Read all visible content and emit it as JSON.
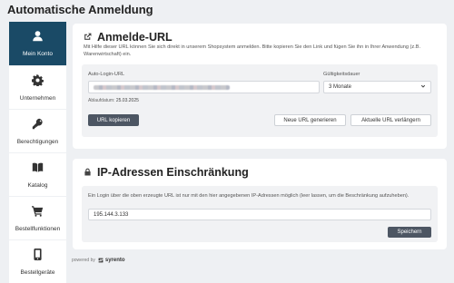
{
  "page": {
    "title": "Automatische Anmeldung"
  },
  "sidebar": {
    "items": [
      {
        "label": "Mein Konto",
        "icon": "user-icon",
        "active": true
      },
      {
        "label": "Unternehmen",
        "icon": "gear-icon"
      },
      {
        "label": "Berechtigungen",
        "icon": "key-icon"
      },
      {
        "label": "Katalog",
        "icon": "book-icon"
      },
      {
        "label": "Bestellfunktionen",
        "icon": "cart-icon"
      },
      {
        "label": "Bestellgeräte",
        "icon": "phone-icon"
      }
    ]
  },
  "footer": {
    "powered_by": "powered by",
    "brand": "syrento"
  },
  "login_url": {
    "title": "Anmelde-URL",
    "icon": "external-link-icon",
    "description": "Mit Hilfe dieser URL können Sie sich direkt in unserem Shopsystem anmelden. Bitte kopieren Sie den Link und fügen Sie ihn in Ihrer Anwendung (z.B. Warenwirtschaft) ein.",
    "url_label": "Auto-Login-URL",
    "expiry_prefix": "Ablaufdatum:",
    "expiry_date": "25.03.2025",
    "validity_label": "Gültigkeitsdauer",
    "validity_value": "3 Monate",
    "copy_button": "URL kopieren",
    "generate_button": "Neue URL generieren",
    "extend_button": "Aktuelle URL verlängern"
  },
  "ip_restriction": {
    "title": "IP-Adressen Einschränkung",
    "icon": "lock-icon",
    "description": "Ein Login über die oben erzeugte URL ist nur mit den hier angegebenen IP-Adressen möglich (leer lassen, um die Beschränkung aufzuheben).",
    "ip_value": "195.144.3.133",
    "save_button": "Speichern"
  }
}
